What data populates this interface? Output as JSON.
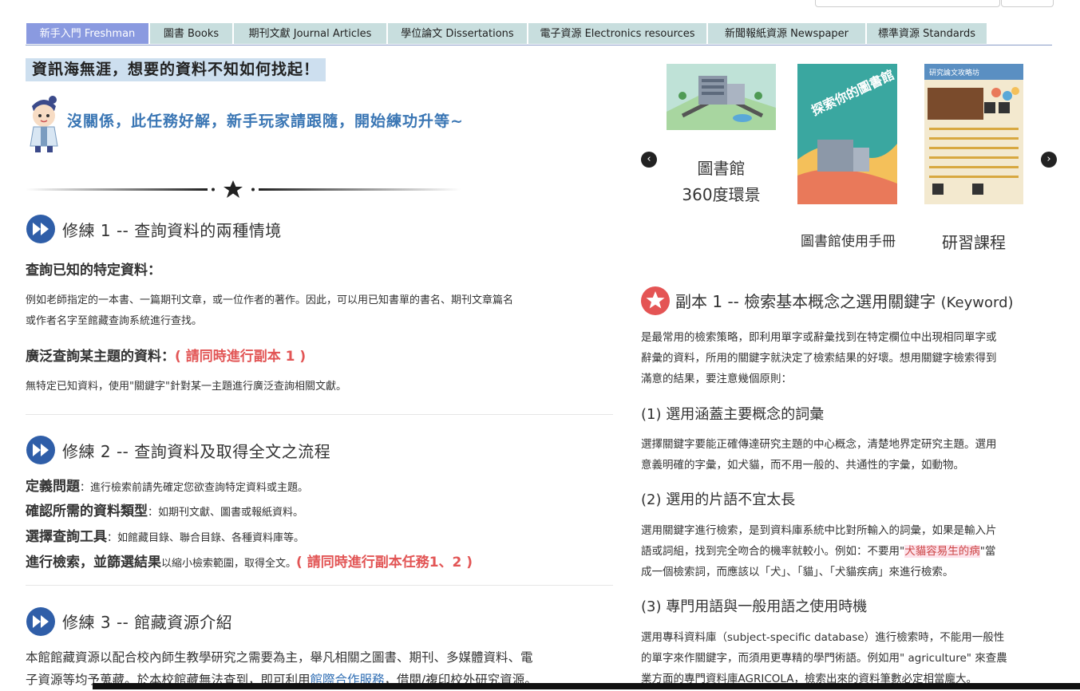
{
  "tabs": [
    {
      "label": "新手入門 Freshman",
      "active": true
    },
    {
      "label": "圖書 Books"
    },
    {
      "label": "期刊文獻 Journal Articles"
    },
    {
      "label": "學位論文 Dissertations"
    },
    {
      "label": "電子資源 Electronics resources"
    },
    {
      "label": "新聞報紙資源 Newspaper"
    },
    {
      "label": "標準資源 Standards"
    }
  ],
  "intro": {
    "headline": "資訊海無涯，想要的資料不知如何找起！",
    "subline": "沒關係，此任務好解，新手玩家請跟隨，開始練功升等~"
  },
  "section1": {
    "title": "修練 1 -- 查詢資料的兩種情境",
    "h1": "查詢已知的特定資料：",
    "p1a": "例如老師指定的一本書、一篇期刊文章，或一位作者的著作。因此，可以用已知書單的書名、期刊文章篇名",
    "p1b": "或作者名字至館藏查詢系統進行查找。",
    "h2": "廣泛查詢某主題的資料：",
    "h2_note": "( 請同時進行副本 1 )",
    "p2": "無特定已知資料，使用\"關鍵字\"針對某一主題進行廣泛查詢相關文獻。"
  },
  "section2": {
    "title": "修練 2 -- 查詢資料及取得全文之流程",
    "steps": [
      {
        "bold": "定義問題",
        "text": "：進行檢索前請先確定您欲查詢特定資料或主題。"
      },
      {
        "bold": "確認所需的資料類型",
        "text": "：如期刊文獻、圖書或報紙資料。"
      },
      {
        "bold": "選擇查詢工具",
        "text": "：如館藏目錄、聯合目錄、各種資料庫等。"
      },
      {
        "bold": "進行檢索，並篩選結果",
        "text": "以縮小檢索範圍，取得全文。",
        "note": "( 請同時進行副本任務1、2 )"
      }
    ]
  },
  "section3": {
    "title": "修練 3 -- 館藏資源介紹",
    "p1": "本館館藏資源以配合校內師生教學研究之需要為主，舉凡相關之圖書、期刊、多媒體資料、電",
    "p2a": "子資源等均予蒐藏。於本校館藏無法查到，即可利用",
    "p2_link": "館際合作服務",
    "p2b": "，借閱/複印校外研究資源。"
  },
  "carousel": {
    "items": [
      {
        "caption_line1": "圖書館",
        "caption_line2": "360度環景"
      },
      {
        "caption": "圖書館使用手冊",
        "cover_text": "探索你的圖書館"
      },
      {
        "caption": "研習課程",
        "cover_text": "研究論文攻略坊"
      }
    ],
    "prev_label": "‹",
    "next_label": "›"
  },
  "copy1": {
    "title": "副本 1 -- 檢索基本概念之選用關鍵字",
    "title_en": "(Keyword)",
    "intro1": "是最常用的檢索策略，即利用單字或辭彙找到在特定欄位中出現相同單字或",
    "intro2": "辭彙的資料，所用的關鍵字就決定了檢索結果的好壞。想用關鍵字檢索得到",
    "intro3": "滿意的結果，要注意幾個原則：",
    "r1_title": "(1) 選用涵蓋主要概念的詞彙",
    "r1_p1": "選擇關鍵字要能正確傳達研究主題的中心概念，清楚地界定研究主題。選用",
    "r1_p2": "意義明確的字彙，如犬貓，而不用一般的、共通性的字彙，如動物。",
    "r2_title": "(2) 選用的片語不宜太長",
    "r2_p1": "選用關鍵字進行檢索，是到資料庫系統中比對所輸入的詞彙，如果是輸入片",
    "r2_p2a": "語或詞組，找到完全吻合的機率就較小。例如：不要用\"",
    "r2_p2_hl": "犬貓容易生的病",
    "r2_p2b": "\"當",
    "r2_p3": "成一個檢索詞，而應該以「犬」、「貓」、「犬貓疾病」來進行檢索。",
    "r3_title": "(3) 專門用語與一般用語之使用時機",
    "r3_p1": "選用專科資料庫（subject-specific database）進行檢索時，不能用一般性",
    "r3_p2": "的單字來作關鍵字，而須用更專精的學門術語。例如用\" agriculture\" 來查農",
    "r3_p3": "業方面的專門資料庫AGRICOLA，檢索出來的資料筆數必定相當龐大。"
  },
  "colors": {
    "accent": "#3a76b4",
    "tab_bg": "#c8dede",
    "tab_active": "#8a9ae0",
    "red_note": "#e25555"
  }
}
